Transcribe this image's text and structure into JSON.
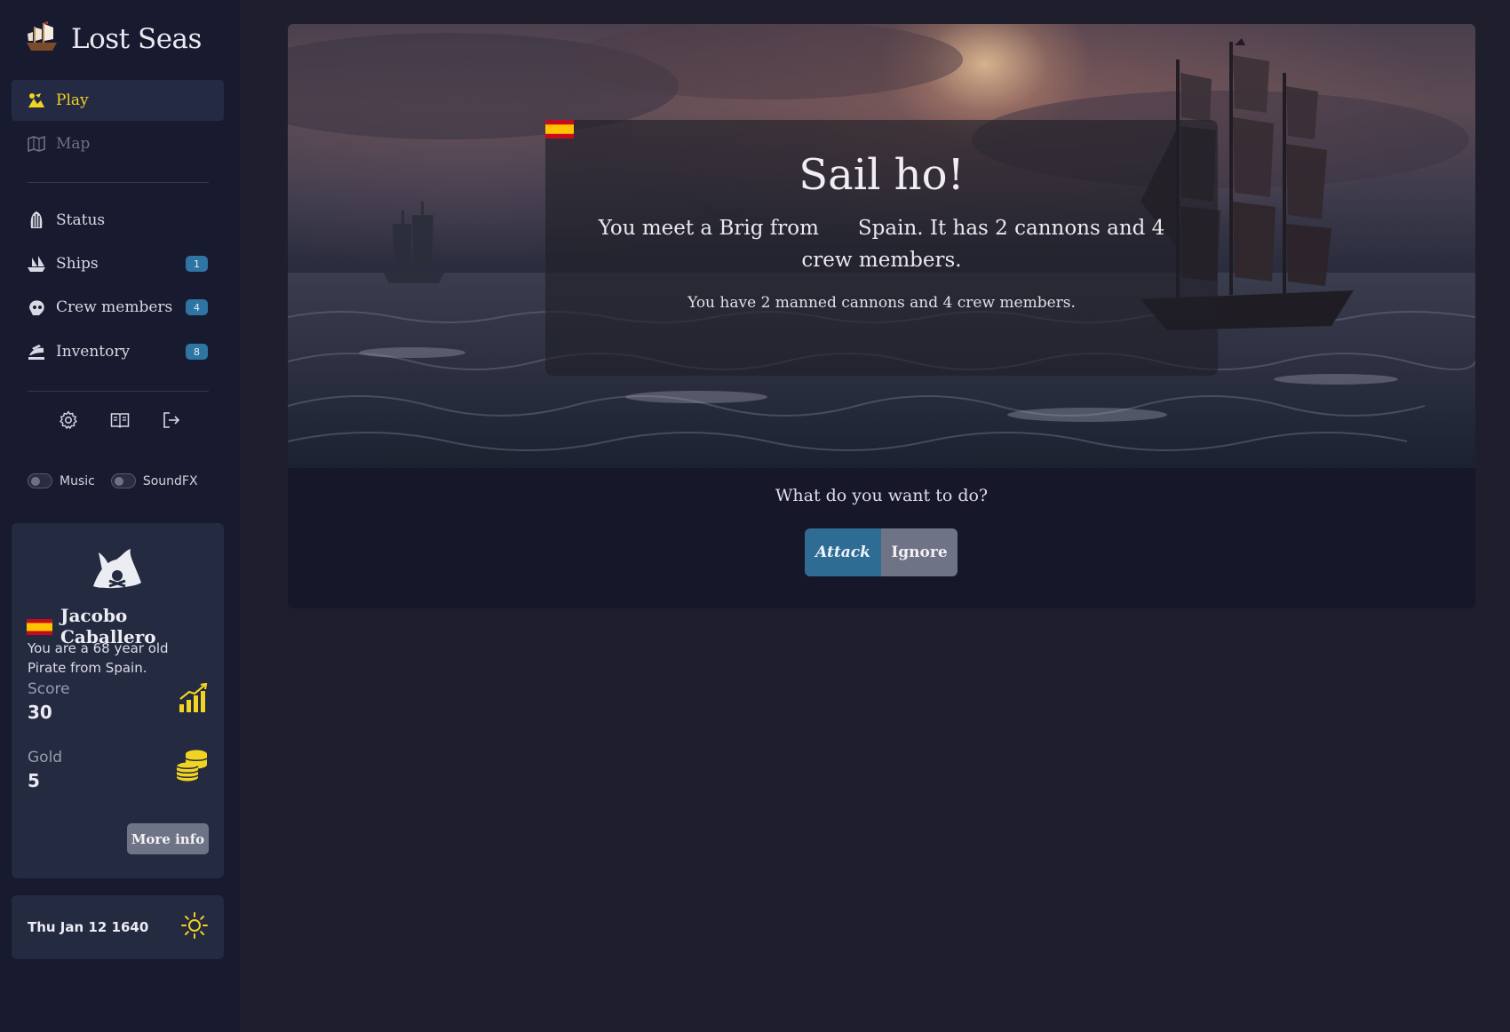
{
  "app": {
    "title": "Lost Seas",
    "logo_icon": "ship-logo-icon"
  },
  "sidebar": {
    "nav_primary": [
      {
        "label": "Play",
        "icon": "play-icon",
        "active": true
      },
      {
        "label": "Map",
        "icon": "map-icon",
        "disabled": true
      }
    ],
    "nav_secondary": [
      {
        "label": "Status",
        "icon": "status-icon"
      },
      {
        "label": "Ships",
        "icon": "ships-icon",
        "badge": "1"
      },
      {
        "label": "Crew members",
        "icon": "crew-icon",
        "badge": "4"
      },
      {
        "label": "Inventory",
        "icon": "inventory-icon",
        "badge": "8"
      }
    ],
    "tools": [
      "settings-icon",
      "book-icon",
      "logout-icon"
    ],
    "toggles": {
      "music_label": "Music",
      "music_on": false,
      "soundfx_label": "SoundFX",
      "soundfx_on": false
    }
  },
  "player": {
    "name": "Jacobo Caballero",
    "nationality_flag": "spain-flag",
    "description": "You are a 68 year old Pirate from Spain.",
    "score_label": "Score",
    "score": "30",
    "gold_label": "Gold",
    "gold": "5",
    "more_info_label": "More info"
  },
  "date": {
    "text": "Thu Jan 12 1640",
    "weather_icon": "sun-icon"
  },
  "encounter": {
    "title": "Sail ho!",
    "text_before_flag": "You meet a Brig from",
    "text_after_flag": "Spain. It has 2 cannons and 4 crew members.",
    "sub": "You have 2 manned cannons and 4 crew members.",
    "prompt": "What do you want to do?",
    "actions": {
      "attack": "Attack",
      "ignore": "Ignore"
    }
  },
  "colors": {
    "accent_yellow": "#f1d323",
    "badge_blue": "#2f75a3",
    "attack_blue": "#2f6c94",
    "ignore_gray": "#6f7386",
    "sidebar_bg": "#181a30",
    "page_bg": "#1e1e2c"
  }
}
